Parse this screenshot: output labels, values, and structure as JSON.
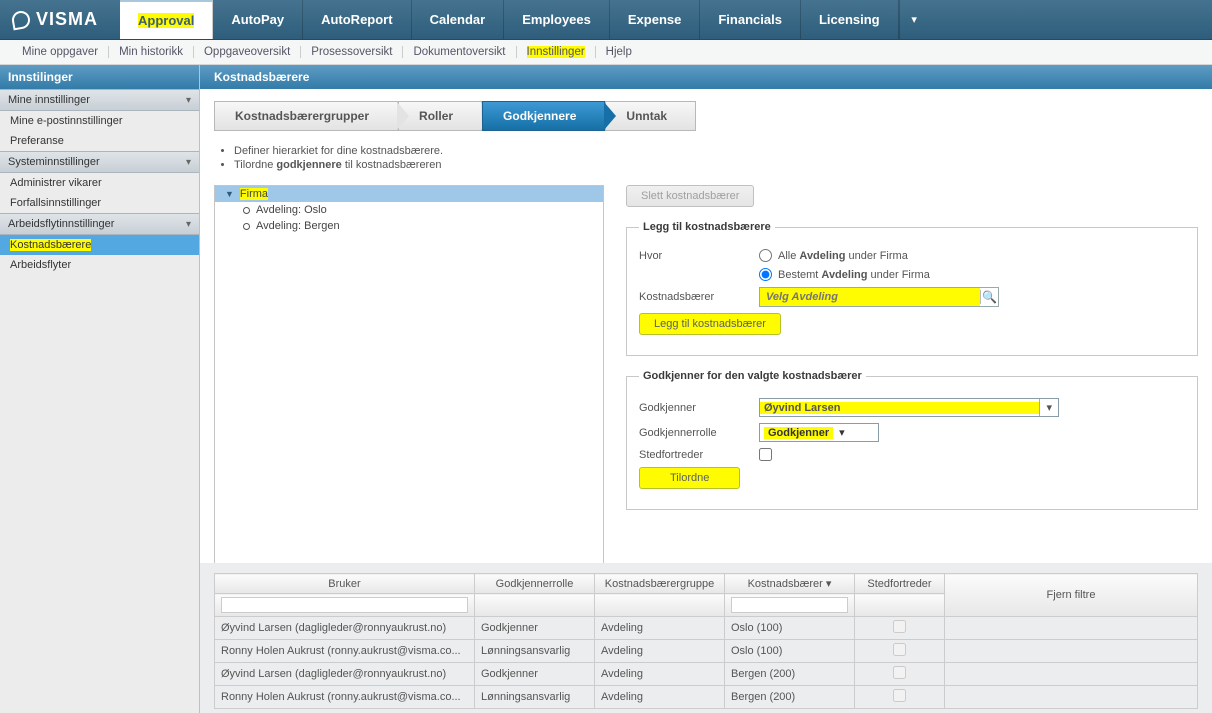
{
  "brand": "VISMA",
  "nav": [
    "Approval",
    "AutoPay",
    "AutoReport",
    "Calendar",
    "Employees",
    "Expense",
    "Financials",
    "Licensing"
  ],
  "nav_active": 0,
  "subnav": [
    "Mine oppgaver",
    "Min historikk",
    "Oppgaveoversikt",
    "Prosessoversikt",
    "Dokumentoversikt",
    "Innstillinger",
    "Hjelp"
  ],
  "subnav_hl_index": 5,
  "sidebar": {
    "title": "Innstilinger",
    "sections": [
      {
        "header": "Mine innstillinger",
        "links": [
          "Mine e-postinnstillinger",
          "Preferanse"
        ]
      },
      {
        "header": "Systeminnstillinger",
        "links": [
          "Administrer vikarer",
          "Forfallsinnstillinger"
        ]
      },
      {
        "header": "Arbeidsflytinnstillinger",
        "links": [
          "Kostnadsbærere",
          "Arbeidsflyter"
        ],
        "active_index": 0
      }
    ]
  },
  "page_title": "Kostnadsbærere",
  "tabs": [
    "Kostnadsbærergrupper",
    "Roller",
    "Godkjennere",
    "Unntak"
  ],
  "tab_active": 2,
  "bullets": [
    "Definer hierarkiet for dine kostnadsbærere.",
    "Tilordne godkjennere til kostnadsbæreren"
  ],
  "bullet_bold_word": "godkjennere",
  "tree": {
    "root": "Firma",
    "children": [
      "Avdeling: Oslo",
      "Avdeling: Bergen"
    ]
  },
  "right": {
    "delete_btn": "Slett kostnadsbærer",
    "add_box": {
      "legend": "Legg til kostnadsbærere",
      "where_lbl": "Hvor",
      "opt_all_prefix": "Alle ",
      "opt_all_bold": "Avdeling",
      "opt_all_suffix": " under Firma",
      "opt_det_prefix": "Bestemt ",
      "opt_det_bold": "Avdeling",
      "opt_det_suffix": " under Firma",
      "cost_lbl": "Kostnadsbærer",
      "search_placeholder": "Velg Avdeling",
      "add_btn": "Legg til kostnadsbærer"
    },
    "approver_box": {
      "legend": "Godkjenner for den valgte kostnadsbærer",
      "approver_lbl": "Godkjenner",
      "approver_val": "Øyvind Larsen",
      "role_lbl": "Godkjennerrolle",
      "role_val": "Godkjenner",
      "deputy_lbl": "Stedfortreder",
      "assign_btn": "Tilordne"
    }
  },
  "grid": {
    "headers": [
      "Bruker",
      "Godkjennerrolle",
      "Kostnadsbærergruppe",
      "Kostnadsbærer",
      "Stedfortreder"
    ],
    "clear_btn": "Fjern filtre",
    "rows": [
      {
        "u": "Øyvind Larsen (dagligleder@ronnyaukrust.no)",
        "r": "Godkjenner",
        "g": "Avdeling",
        "c": "Oslo (100)"
      },
      {
        "u": "Ronny Holen Aukrust (ronny.aukrust@visma.co...",
        "r": "Lønningsansvarlig",
        "g": "Avdeling",
        "c": "Oslo (100)"
      },
      {
        "u": "Øyvind Larsen (dagligleder@ronnyaukrust.no)",
        "r": "Godkjenner",
        "g": "Avdeling",
        "c": "Bergen (200)"
      },
      {
        "u": "Ronny Holen Aukrust (ronny.aukrust@visma.co...",
        "r": "Lønningsansvarlig",
        "g": "Avdeling",
        "c": "Bergen (200)"
      }
    ]
  }
}
